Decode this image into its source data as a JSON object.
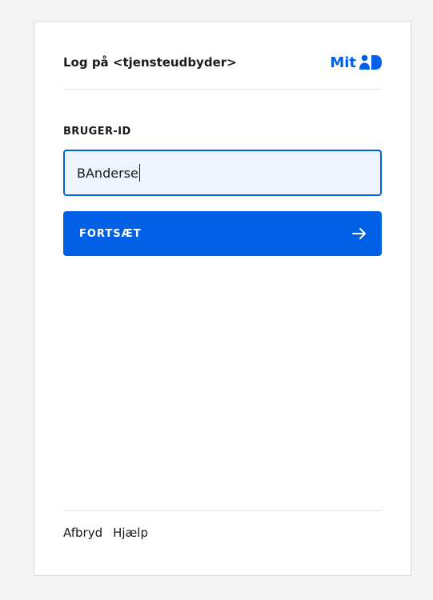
{
  "header": {
    "title": "Log på <tjensteudbyder>",
    "logo_text": "Mit"
  },
  "login": {
    "field_label": "BRUGER-ID",
    "user_id_value": "BAnderse",
    "continue_label": "FORTSÆT"
  },
  "footer": {
    "cancel_label": "Afbryd",
    "help_label": "Hjælp"
  },
  "colors": {
    "brand_blue": "#0060e6",
    "input_background": "#eef4fc",
    "text": "#1a1a1a"
  },
  "icons": {
    "logo": "mitid-logo-icon",
    "continue": "arrow-right-icon"
  }
}
